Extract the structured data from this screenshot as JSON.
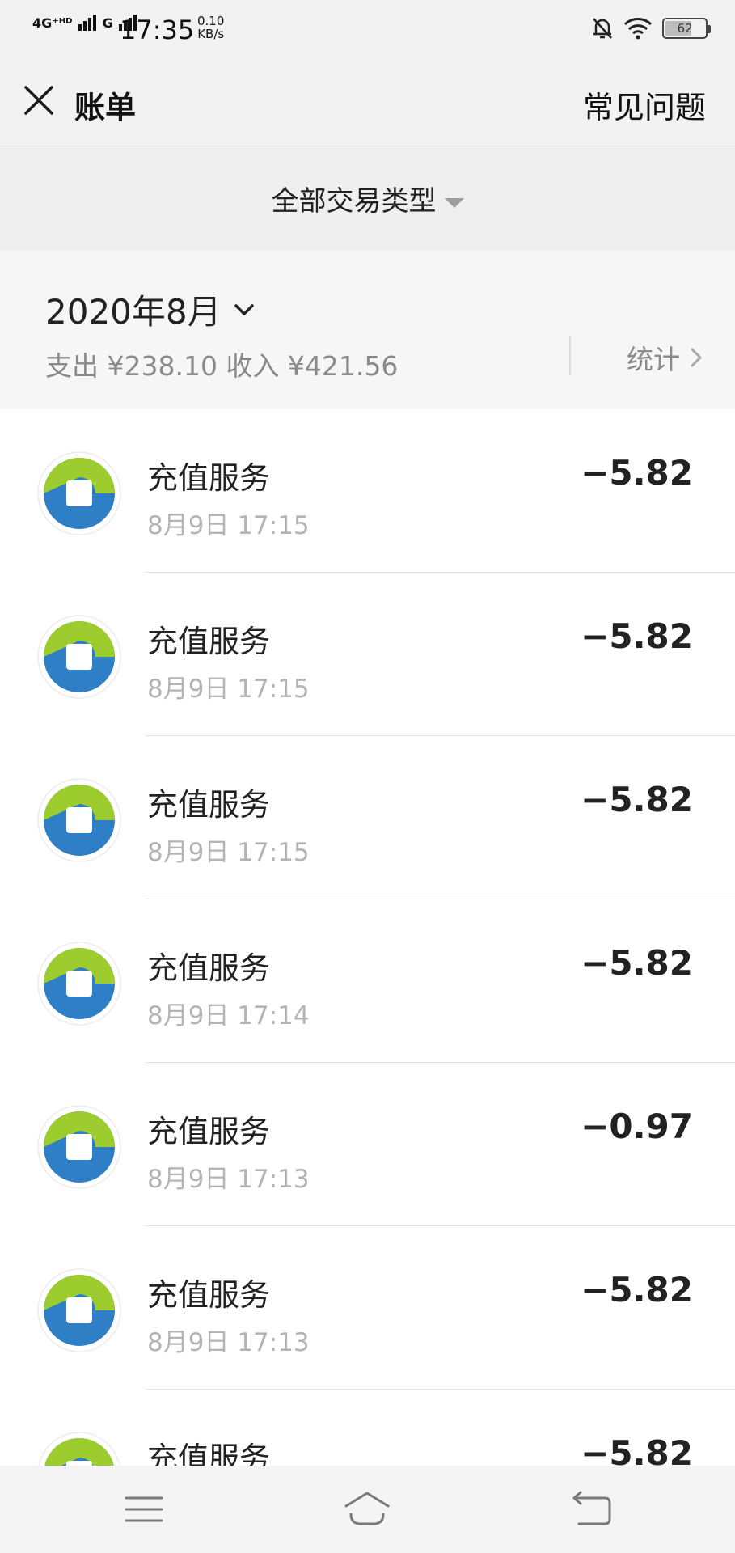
{
  "status_bar": {
    "network_1": "4G⁺ᴴᴰ",
    "network_2": "G",
    "time": "17:35",
    "speed_value": "0.10",
    "speed_unit": "KB/s",
    "battery": "62"
  },
  "header": {
    "title": "账单",
    "faq": "常见问题"
  },
  "filter": {
    "label": "全部交易类型"
  },
  "summary": {
    "month": "2020年8月",
    "totals": "支出 ¥238.10 收入 ¥421.56",
    "stats": "统计"
  },
  "transactions": [
    {
      "title": "充值服务",
      "time": "8月9日 17:15",
      "amount": "−5.82"
    },
    {
      "title": "充值服务",
      "time": "8月9日 17:15",
      "amount": "−5.82"
    },
    {
      "title": "充值服务",
      "time": "8月9日 17:15",
      "amount": "−5.82"
    },
    {
      "title": "充值服务",
      "time": "8月9日 17:14",
      "amount": "−5.82"
    },
    {
      "title": "充值服务",
      "time": "8月9日 17:13",
      "amount": "−0.97"
    },
    {
      "title": "充值服务",
      "time": "8月9日 17:13",
      "amount": "−5.82"
    },
    {
      "title": "充值服务",
      "time": "",
      "amount": "−5.82"
    }
  ],
  "icons": {
    "close": "close-icon",
    "month_toggle": "chevron-down-icon",
    "stats": "chevron-right-icon",
    "merchant": "merchant-logo-icon",
    "nav_menu": "menu-icon",
    "nav_home": "home-icon",
    "nav_back": "back-icon"
  },
  "colors": {
    "header_bg": "#f2f2f2",
    "muted_text": "#8a8a8a",
    "time_text": "#b4b4b4"
  }
}
